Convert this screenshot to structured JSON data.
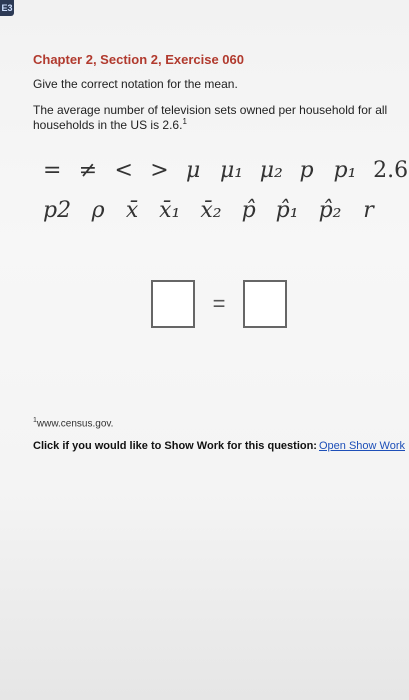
{
  "header": {
    "corner_tab": "E3"
  },
  "exercise": {
    "title": "Chapter 2, Section 2, Exercise 060",
    "prompt": "Give the correct notation for the mean.",
    "question": "The average number of television sets owned per household for all households in the US is 2.6.",
    "question_sup": "1"
  },
  "palette": {
    "row1": [
      "=",
      "≠",
      "<",
      ">",
      "μ",
      "μ₁",
      "μ₂",
      "p",
      "p₁",
      "2.6"
    ],
    "row2": [
      "p2",
      "ρ",
      "x̄",
      "x̄₁",
      "x̄₂",
      "p̂",
      "p̂₁",
      "p̂₂",
      "r"
    ]
  },
  "answer": {
    "equals": "="
  },
  "footnote": {
    "sup": "1",
    "text": "www.census.gov."
  },
  "show_work": {
    "label": "Click if you would like to Show Work for this question:",
    "link": "Open Show Work"
  },
  "colors": {
    "title": "#b13a2e",
    "link": "#1d4fb8"
  }
}
